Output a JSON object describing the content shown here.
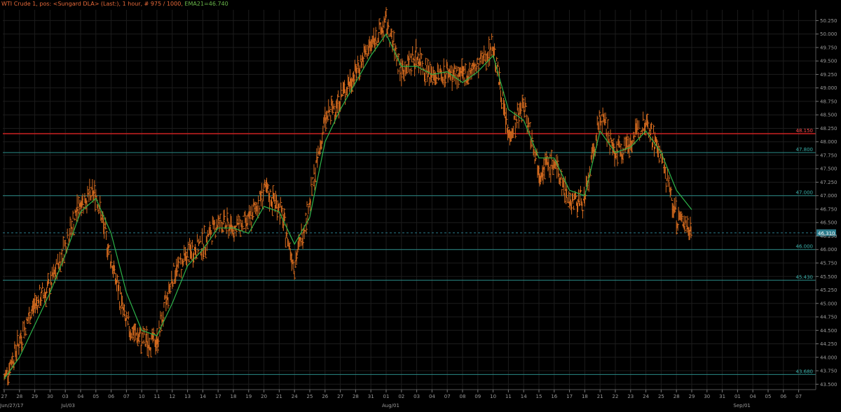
{
  "header": {
    "title": "WTI Crude 1, pos: <Sungard DLA> (Last:), 1 hour, # 975 / 1000,",
    "ema_label": "EMA21=46.740"
  },
  "colors": {
    "background": "#000000",
    "grid": "#1c1c1c",
    "candle": "#d2691e",
    "ema": "#2db34a",
    "level_line": "#2a8a86",
    "resistance_line": "#cc2222",
    "current_price_line": "#2a7a8a"
  },
  "chart_data": {
    "type": "line",
    "series": [
      {
        "name": "WTI Crude 1",
        "style": "hlc-bars",
        "x": [
          "06-27",
          "06-28",
          "06-29",
          "06-30",
          "07-03",
          "07-04",
          "07-05",
          "07-06",
          "07-07",
          "07-10",
          "07-11",
          "07-12",
          "07-13",
          "07-14",
          "07-17",
          "07-18",
          "07-19",
          "07-20",
          "07-21",
          "07-24",
          "07-25",
          "07-26",
          "07-27",
          "07-28",
          "07-31",
          "08-01",
          "08-02",
          "08-03",
          "08-04",
          "08-07",
          "08-08",
          "08-09",
          "08-10",
          "08-11",
          "08-14",
          "08-15",
          "08-16",
          "08-17",
          "08-18",
          "08-21",
          "08-22",
          "08-23",
          "08-24",
          "08-25",
          "08-28",
          "08-29"
        ],
        "values": [
          43.6,
          44.3,
          45.0,
          45.3,
          46.1,
          46.9,
          47.05,
          45.8,
          44.6,
          44.3,
          44.3,
          45.5,
          45.9,
          46.1,
          46.5,
          46.4,
          46.5,
          47.1,
          46.8,
          45.7,
          46.9,
          48.4,
          48.8,
          49.3,
          49.8,
          50.2,
          49.3,
          49.6,
          49.2,
          49.3,
          49.2,
          49.4,
          49.8,
          48.1,
          48.7,
          47.5,
          47.6,
          46.9,
          46.9,
          48.5,
          47.8,
          48.0,
          48.4,
          47.7,
          46.6,
          46.4
        ]
      },
      {
        "name": "EMA21",
        "x": [
          "06-27",
          "06-28",
          "06-29",
          "06-30",
          "07-03",
          "07-04",
          "07-05",
          "07-06",
          "07-07",
          "07-10",
          "07-11",
          "07-12",
          "07-13",
          "07-14",
          "07-17",
          "07-18",
          "07-19",
          "07-20",
          "07-21",
          "07-24",
          "07-25",
          "07-26",
          "07-27",
          "07-28",
          "07-31",
          "08-01",
          "08-02",
          "08-03",
          "08-04",
          "08-07",
          "08-08",
          "08-09",
          "08-10",
          "08-11",
          "08-14",
          "08-15",
          "08-16",
          "08-17",
          "08-18",
          "08-21",
          "08-22",
          "08-23",
          "08-24",
          "08-25",
          "08-28",
          "08-29"
        ],
        "values": [
          43.6,
          44.0,
          44.6,
          45.2,
          45.9,
          46.7,
          46.95,
          46.3,
          45.2,
          44.5,
          44.4,
          45.0,
          45.7,
          46.0,
          46.4,
          46.4,
          46.3,
          46.8,
          46.7,
          46.1,
          46.6,
          48.0,
          48.6,
          49.1,
          49.6,
          50.0,
          49.4,
          49.4,
          49.25,
          49.3,
          49.1,
          49.3,
          49.6,
          48.6,
          48.4,
          47.7,
          47.7,
          47.1,
          47.0,
          48.2,
          47.8,
          47.9,
          48.2,
          47.8,
          47.1,
          46.74
        ]
      }
    ],
    "horizontal_lines": [
      {
        "value": 48.15,
        "label": "48.150",
        "role": "resistance"
      },
      {
        "value": 47.8,
        "label": "47.800",
        "role": "level"
      },
      {
        "value": 47.0,
        "label": "47.000",
        "role": "level"
      },
      {
        "value": 46.31,
        "label": "46.310",
        "role": "current"
      },
      {
        "value": 46.0,
        "label": "46.000",
        "role": "level"
      },
      {
        "value": 45.43,
        "label": "45.430",
        "role": "level"
      },
      {
        "value": 43.68,
        "label": "43.680",
        "role": "level"
      }
    ],
    "y_ticks": [
      43.5,
      43.75,
      44.0,
      44.25,
      44.5,
      44.75,
      45.0,
      45.25,
      45.5,
      45.75,
      46.0,
      46.25,
      46.5,
      46.75,
      47.0,
      47.25,
      47.5,
      47.75,
      48.0,
      48.25,
      48.5,
      48.75,
      49.0,
      49.25,
      49.5,
      49.75,
      50.0,
      50.25
    ],
    "y_tick_labels": [
      "43.500",
      "43.750",
      "44.000",
      "44.250",
      "44.500",
      "44.750",
      "45.000",
      "45.250",
      "45.500",
      "45.750",
      "46.000",
      "46.250",
      "46.500",
      "46.750",
      "47.000",
      "47.250",
      "47.500",
      "47.750",
      "48.000",
      "48.250",
      "48.500",
      "48.750",
      "49.000",
      "49.250",
      "49.500",
      "49.750",
      "50.000",
      "50.250"
    ],
    "ylim": [
      43.4,
      50.45
    ],
    "x_day_labels": [
      "27",
      "28",
      "29",
      "30",
      "03",
      "04",
      "05",
      "06",
      "07",
      "10",
      "11",
      "12",
      "13",
      "14",
      "17",
      "18",
      "19",
      "20",
      "21",
      "24",
      "25",
      "26",
      "27",
      "28",
      "31",
      "01",
      "02",
      "03",
      "04",
      "07",
      "08",
      "09",
      "10",
      "11",
      "14",
      "15",
      "16",
      "17",
      "18",
      "21",
      "22",
      "23",
      "24",
      "25",
      "28",
      "29",
      "30",
      "31",
      "01",
      "04",
      "05",
      "06",
      "07"
    ],
    "x_month_labels": [
      {
        "after_day_index": 0,
        "label": "Jun/27/17"
      },
      {
        "after_day_index": 4,
        "label": "Jul/03"
      },
      {
        "after_day_index": 25,
        "label": "Aug/01"
      },
      {
        "after_day_index": 48,
        "label": "Sep/01"
      }
    ],
    "grid": true
  }
}
